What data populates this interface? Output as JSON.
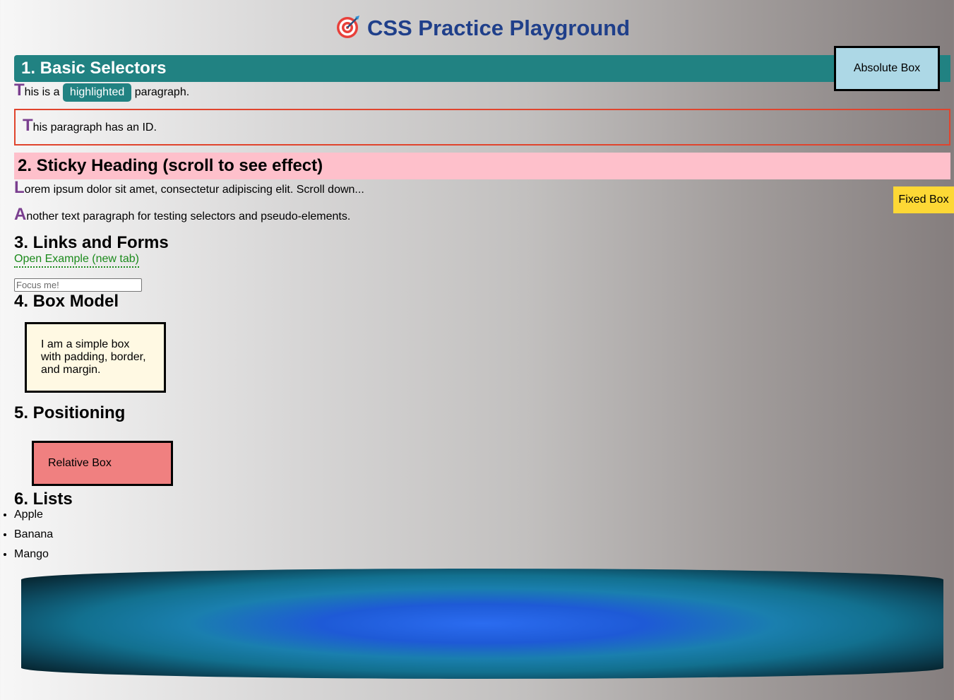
{
  "page": {
    "title": "CSS Practice Playground",
    "title_icon": "target-icon"
  },
  "sections": {
    "basic": {
      "heading": "1. Basic Selectors",
      "para1": {
        "first": "T",
        "before": "his is a ",
        "highlight": "highlighted",
        "after": " paragraph."
      },
      "para2": {
        "first": "T",
        "rest": "his paragraph has an ID."
      }
    },
    "sticky": {
      "heading": "2. Sticky Heading (scroll to see effect)",
      "para1": {
        "first": "L",
        "rest": "orem ipsum dolor sit amet, consectetur adipiscing elit. Scroll down..."
      },
      "para2": {
        "first": "A",
        "rest": "nother text paragraph for testing selectors and pseudo-elements."
      }
    },
    "links": {
      "heading": "3. Links and Forms",
      "link_text": "Open Example (new tab)",
      "input_placeholder": "Focus me!"
    },
    "box_model": {
      "heading": "4. Box Model",
      "box_text": "I am a simple box with padding, border, and margin."
    },
    "positioning": {
      "heading": "5. Positioning",
      "relative_label": "Relative Box",
      "absolute_label": "Absolute Box",
      "fixed_label": "Fixed Box"
    },
    "lists": {
      "heading": "6. Lists",
      "items": [
        "Apple",
        "Banana",
        "Mango"
      ]
    }
  },
  "colors": {
    "title": "#1f3f8a",
    "teal": "#218282",
    "pink": "#fec0cb",
    "first_letter": "#7a3f8f",
    "id_border": "#e0442d",
    "link": "#1b8a1b",
    "relative_box": "#f08080",
    "absolute_box": "#add8e6",
    "fixed_box": "#fdd835",
    "simple_box": "#fff9e3"
  }
}
